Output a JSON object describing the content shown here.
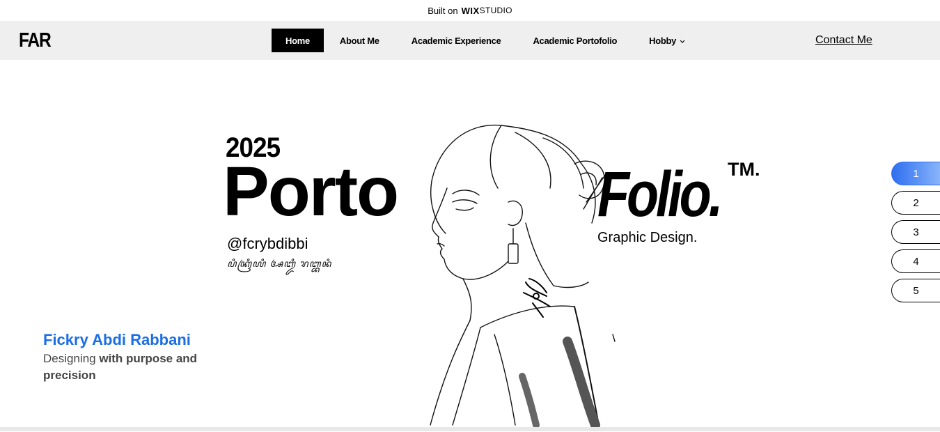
{
  "banner": {
    "built_on": "Built on",
    "brand": "WIX",
    "studio": "STUDIO"
  },
  "header": {
    "logo": "FAR",
    "nav": [
      {
        "label": "Home",
        "active": true
      },
      {
        "label": "About Me"
      },
      {
        "label": "Academic Experience"
      },
      {
        "label": "Academic Portofolio"
      },
      {
        "label": "Hobby",
        "dropdown_icon": "chevron-down-icon"
      }
    ],
    "contact": "Contact Me"
  },
  "hero": {
    "year": "2025",
    "porto": "Porto",
    "handle": "@fcrybdibbi",
    "script_text": "ꦥꦶꦏꦿꦶꦪꦶ ꦄꦧ꧀ꦢꦶ ꦫꦧ꧀ꦧꦤꦶ",
    "folio": "Folio.",
    "tm": "TM.",
    "subtitle": "Graphic Design.",
    "illustration": "woman-profile-sketch"
  },
  "author": {
    "name": "Fickry Abdi Rabbani",
    "tagline_prefix": "Designing ",
    "tagline_bold": "with purpose and precision"
  },
  "pager": {
    "pages": [
      "1",
      "2",
      "3",
      "4",
      "5"
    ],
    "active_index": 0,
    "accent": "#2f6ff0"
  },
  "colors": {
    "accent_blue": "#1b6ee6",
    "header_bg": "#efefef"
  }
}
